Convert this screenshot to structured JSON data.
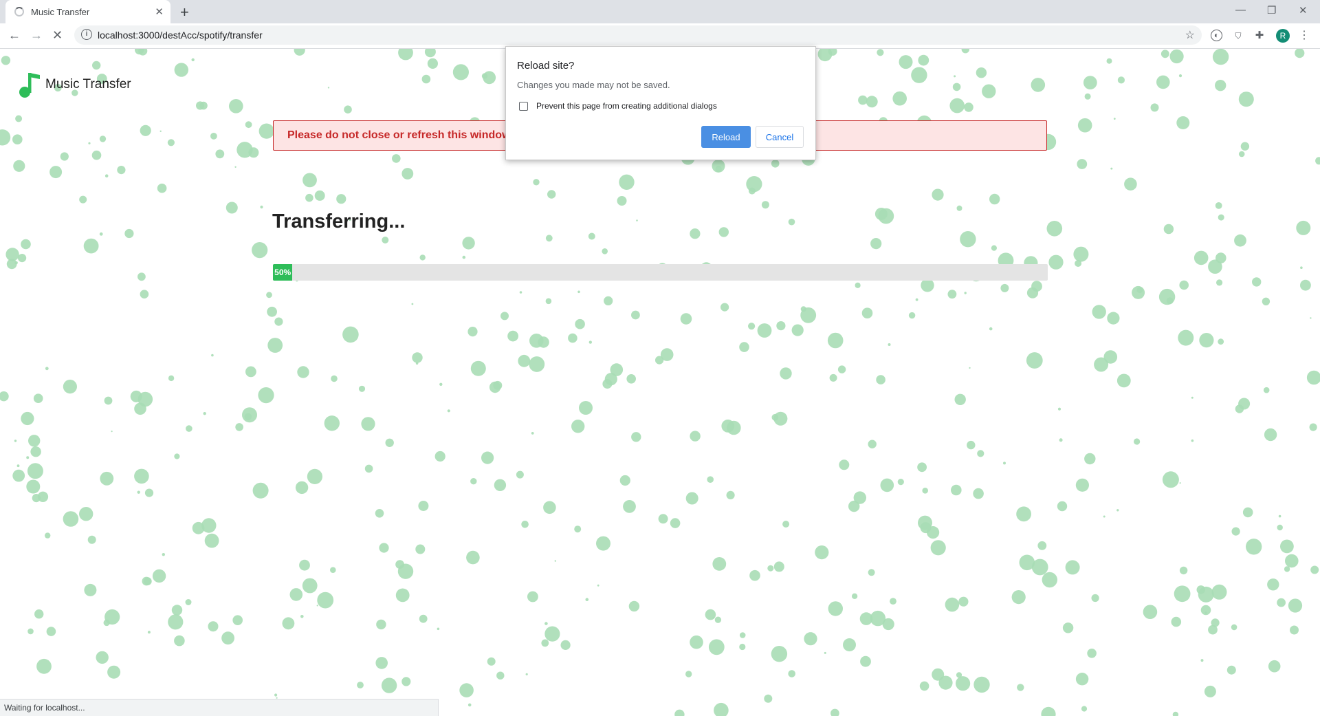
{
  "browser": {
    "tab_title": "Music Transfer",
    "url": "localhost:3000/destAcc/spotify/transfer",
    "profile_initial": "R",
    "status_text": "Waiting for localhost..."
  },
  "page": {
    "brand": "Music Transfer",
    "alert_text": "Please do not close or refresh this window",
    "heading": "Transferring...",
    "progress": {
      "label": "50%",
      "fraction": 0.025
    }
  },
  "dialog": {
    "title": "Reload site?",
    "message": "Changes you made may not be saved.",
    "checkbox_label": "Prevent this page from creating additional dialogs",
    "reload_label": "Reload",
    "cancel_label": "Cancel"
  },
  "colors": {
    "accent_green": "#2ebd59",
    "bubble_green": "#a8ddb5",
    "alert_red": "#c62828",
    "alert_bg": "#fde4e4",
    "dialog_blue": "#4a8fe3"
  }
}
